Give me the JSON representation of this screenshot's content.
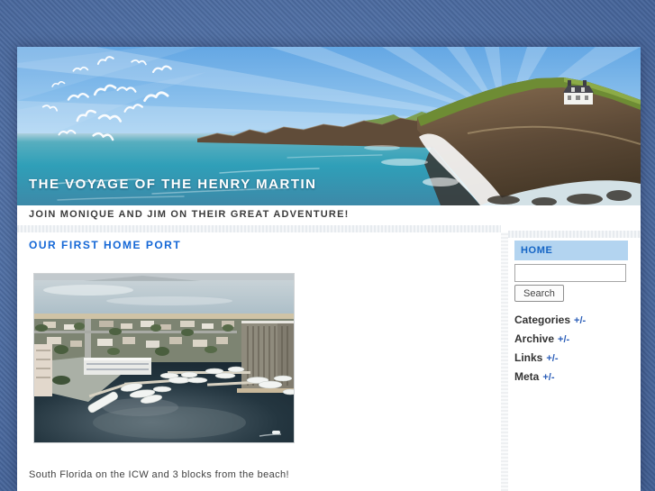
{
  "header": {
    "site_title": "THE VOYAGE OF THE HENRY MARTIN",
    "tagline": "JOIN MONIQUE AND JIM ON THEIR GREAT ADVENTURE!"
  },
  "post": {
    "title": "OUR FIRST HOME PORT",
    "caption": "South Florida on the ICW and 3 blocks from the beach!"
  },
  "sidebar": {
    "home_label": "HOME",
    "search": {
      "value": "",
      "button_label": "Search"
    },
    "sections": [
      {
        "label": "Categories",
        "toggle": "+/-"
      },
      {
        "label": "Archive",
        "toggle": "+/-"
      },
      {
        "label": "Links",
        "toggle": "+/-"
      },
      {
        "label": "Meta",
        "toggle": "+/-"
      }
    ]
  },
  "colors": {
    "accent_blue": "#1467d6",
    "home_bar_bg": "#b3d4f0",
    "link_blue": "#2a5db8",
    "page_background": "#4f72aa",
    "tagline_text": "#3b3b3b"
  }
}
